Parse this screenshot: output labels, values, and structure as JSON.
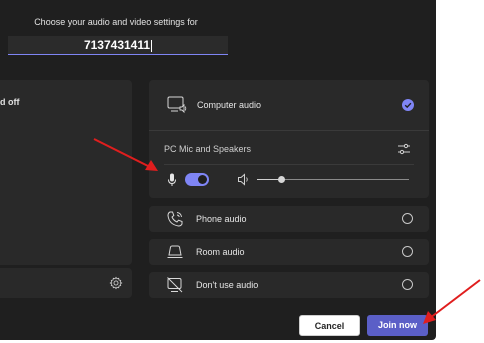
{
  "header": {
    "subtitle": "Choose your audio and video settings for",
    "meeting_id": "7137431411"
  },
  "video": {
    "status_text": "d off",
    "settings_icon": "gear-icon"
  },
  "audio": {
    "computer_audio": {
      "label": "Computer audio",
      "icon": "computer-speaker-icon",
      "selected": true
    },
    "device_label": "PC Mic and Speakers",
    "device_settings_icon": "sliders-icon",
    "mic_toggle_on": true,
    "volume_level": 0.16,
    "options": [
      {
        "label": "Phone audio",
        "icon": "phone-icon",
        "selected": false
      },
      {
        "label": "Room audio",
        "icon": "room-icon",
        "selected": false
      },
      {
        "label": "Don't use audio",
        "icon": "no-audio-icon",
        "selected": false
      }
    ]
  },
  "buttons": {
    "cancel": "Cancel",
    "join": "Join now"
  },
  "colors": {
    "accent": "#7f85f5",
    "join_button": "#5b5fc7",
    "annotation_arrow": "#e01e1e",
    "panel_bg": "#1f1f1f",
    "card_bg": "#292929"
  }
}
